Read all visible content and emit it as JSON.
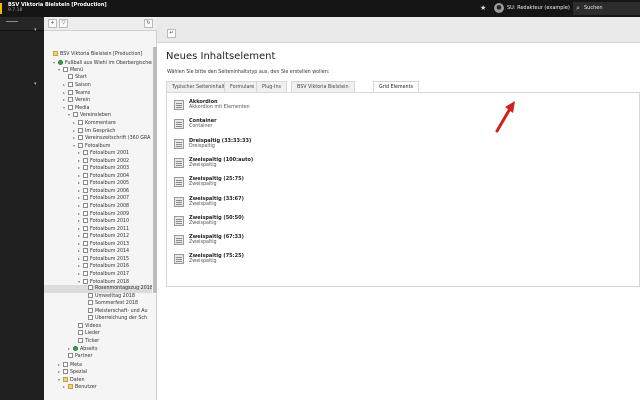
{
  "topbar": {
    "site_name": "BSV Viktoria Bielstein [Production]",
    "version": "9.7.18",
    "bookmark_icon": "star-icon",
    "user_label": "SU: Redakteur (example)",
    "search_label": "Suchen"
  },
  "colors": {
    "topbar": "#151515",
    "module_menu": "#1f1f1f",
    "accent_arrow": "#d0211c",
    "root_icon": "#37a24a"
  },
  "tree": [
    {
      "label": "BSV Viktoria Bielstein [Production]",
      "level": 0,
      "toggle": "",
      "icon": "folder"
    },
    {
      "label": "Fußball aus Wiehl im Oberbergischen",
      "level": 1,
      "toggle": "▾",
      "icon": "root"
    },
    {
      "label": "Menü",
      "level": 2,
      "toggle": "▾",
      "icon": "page"
    },
    {
      "label": "Start",
      "level": 3,
      "toggle": "",
      "icon": "page"
    },
    {
      "label": "Saison",
      "level": 3,
      "toggle": "▸",
      "icon": "page"
    },
    {
      "label": "Teams",
      "level": 3,
      "toggle": "▸",
      "icon": "page"
    },
    {
      "label": "Verein",
      "level": 3,
      "toggle": "▸",
      "icon": "page"
    },
    {
      "label": "Media",
      "level": 3,
      "toggle": "▾",
      "icon": "page"
    },
    {
      "label": "Vereinsleben",
      "level": 4,
      "toggle": "▾",
      "icon": "page"
    },
    {
      "label": "Kommentare",
      "level": 5,
      "toggle": "▸",
      "icon": "page"
    },
    {
      "label": "Im Gespräch",
      "level": 5,
      "toggle": "▸",
      "icon": "page"
    },
    {
      "label": "Vereinszeitschrift (360 GRA",
      "level": 5,
      "toggle": "▸",
      "icon": "page"
    },
    {
      "label": "Fotoalbum",
      "level": 5,
      "toggle": "▾",
      "icon": "page"
    },
    {
      "label": "Fotoalbum 2001",
      "level": 6,
      "toggle": "▸",
      "icon": "page"
    },
    {
      "label": "Fotoalbum 2002",
      "level": 6,
      "toggle": "▸",
      "icon": "page"
    },
    {
      "label": "Fotoalbum 2003",
      "level": 6,
      "toggle": "▸",
      "icon": "page"
    },
    {
      "label": "Fotoalbum 2004",
      "level": 6,
      "toggle": "▸",
      "icon": "page"
    },
    {
      "label": "Fotoalbum 2005",
      "level": 6,
      "toggle": "▸",
      "icon": "page"
    },
    {
      "label": "Fotoalbum 2006",
      "level": 6,
      "toggle": "▸",
      "icon": "page"
    },
    {
      "label": "Fotoalbum 2007",
      "level": 6,
      "toggle": "▸",
      "icon": "page"
    },
    {
      "label": "Fotoalbum 2008",
      "level": 6,
      "toggle": "▸",
      "icon": "page"
    },
    {
      "label": "Fotoalbum 2009",
      "level": 6,
      "toggle": "▸",
      "icon": "page"
    },
    {
      "label": "Fotoalbum 2010",
      "level": 6,
      "toggle": "▸",
      "icon": "page"
    },
    {
      "label": "Fotoalbum 2011",
      "level": 6,
      "toggle": "▸",
      "icon": "page"
    },
    {
      "label": "Fotoalbum 2012",
      "level": 6,
      "toggle": "▸",
      "icon": "page"
    },
    {
      "label": "Fotoalbum 2013",
      "level": 6,
      "toggle": "▸",
      "icon": "page"
    },
    {
      "label": "Fotoalbum 2014",
      "level": 6,
      "toggle": "▸",
      "icon": "page"
    },
    {
      "label": "Fotoalbum 2015",
      "level": 6,
      "toggle": "▸",
      "icon": "page"
    },
    {
      "label": "Fotoalbum 2016",
      "level": 6,
      "toggle": "▸",
      "icon": "page"
    },
    {
      "label": "Fotoalbum 2017",
      "level": 6,
      "toggle": "▸",
      "icon": "page"
    },
    {
      "label": "Fotoalbum 2018",
      "level": 6,
      "toggle": "▾",
      "icon": "page"
    },
    {
      "label": "Rosenmontagszug 2018",
      "level": 7,
      "toggle": "",
      "icon": "page",
      "selected": true
    },
    {
      "label": "Umwelttag 2018",
      "level": 7,
      "toggle": "",
      "icon": "page"
    },
    {
      "label": "Sommerfest 2018",
      "level": 7,
      "toggle": "",
      "icon": "page"
    },
    {
      "label": "Meisterschaft- und Au",
      "level": 7,
      "toggle": "",
      "icon": "page"
    },
    {
      "label": "Überreichung der Sch",
      "level": 7,
      "toggle": "",
      "icon": "page"
    },
    {
      "label": "Videos",
      "level": 5,
      "toggle": "",
      "icon": "page"
    },
    {
      "label": "Lieder",
      "level": 5,
      "toggle": "",
      "icon": "page"
    },
    {
      "label": "Ticker",
      "level": 5,
      "toggle": "",
      "icon": "page"
    },
    {
      "label": "Abseits",
      "level": 4,
      "toggle": "▸",
      "icon": "root"
    },
    {
      "label": "Partner",
      "level": 3,
      "toggle": "",
      "icon": "page"
    },
    {
      "label": "Meta",
      "level": 2,
      "toggle": "▸",
      "icon": "page"
    },
    {
      "label": "Spezial",
      "level": 2,
      "toggle": "▸",
      "icon": "page"
    },
    {
      "label": "Daten",
      "level": 2,
      "toggle": "▾",
      "icon": "folder"
    },
    {
      "label": "Benutzer",
      "level": 3,
      "toggle": "▸",
      "icon": "folder"
    }
  ],
  "content": {
    "heading": "Neues Inhaltselement",
    "intro": "Wählen Sie bitte den Seiteninhaltstyp aus, den Sie erstellen wollen:",
    "tabs": [
      {
        "label": "Typischer Seiteninhalt"
      },
      {
        "label": "Formulare"
      },
      {
        "label": "Plug-Ins"
      },
      {
        "label": "BSV Viktoria Bielstein"
      },
      {
        "label": "Grid Elements",
        "active": true
      }
    ],
    "items": [
      {
        "title": "Akkordion",
        "desc": "Akkordion mit Elementen"
      },
      {
        "title": "Container",
        "desc": "Container"
      },
      {
        "title": "Dreispaltig (33:33:33)",
        "desc": "Dreispaltig"
      },
      {
        "title": "Zweispaltig (100:auto)",
        "desc": "Zweispaltig"
      },
      {
        "title": "Zweispaltig (25:75)",
        "desc": "Zweispaltig"
      },
      {
        "title": "Zweispaltig (33:67)",
        "desc": "Zweispaltig"
      },
      {
        "title": "Zweispaltig (50:50)",
        "desc": "Zweispaltig"
      },
      {
        "title": "Zweispaltig (67:33)",
        "desc": "Zweispaltig"
      },
      {
        "title": "Zweispaltig (75:25)",
        "desc": "Zweispaltig"
      }
    ]
  }
}
